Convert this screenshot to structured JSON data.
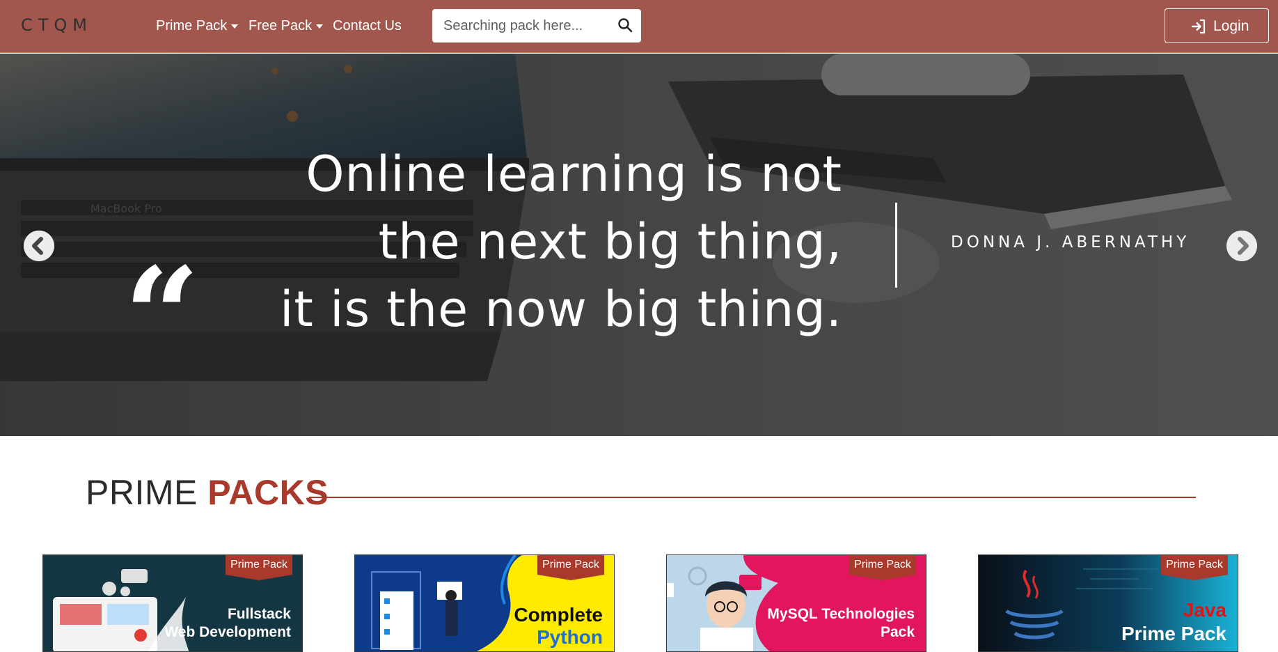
{
  "nav": {
    "brand": "CTQM",
    "links": [
      {
        "label": "Prime Pack",
        "dropdown": true
      },
      {
        "label": "Free Pack",
        "dropdown": true
      },
      {
        "label": "Contact Us",
        "dropdown": false
      }
    ],
    "search": {
      "placeholder": "Searching pack here...",
      "value": ""
    },
    "login_label": "Login"
  },
  "hero": {
    "quote_mark": "“",
    "quote_lines": [
      "Online learning is not",
      "the next big thing,",
      "it is the now big thing."
    ],
    "author": "DONNA J. ABERNATHY",
    "laptop_label": "MacBook Pro"
  },
  "section": {
    "title_plain": "PRIME ",
    "title_accent": "PACKS"
  },
  "cards": [
    {
      "badge": "Prime Pack",
      "title_lines": [
        "Fullstack",
        "Web Development"
      ]
    },
    {
      "badge": "Prime Pack",
      "title_lines": [
        "Complete",
        "Python"
      ]
    },
    {
      "badge": "Prime Pack",
      "title_lines": [
        "MySQL Technologies",
        "Pack"
      ]
    },
    {
      "badge": "Prime Pack",
      "title_lines": [
        "Java",
        "Prime Pack"
      ]
    }
  ],
  "colors": {
    "navbar": "#a1574d",
    "accent": "#a8392b",
    "badge": "#a8392b"
  }
}
